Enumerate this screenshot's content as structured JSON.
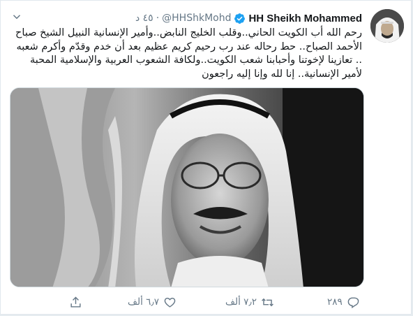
{
  "tweet": {
    "author": {
      "display_name": "HH Sheikh Mohammed",
      "handle": "@HHShkMohd",
      "verified_icon": "verified-badge-icon",
      "avatar_icon": "profile-avatar"
    },
    "separator": "·",
    "time": "٤٥ د",
    "menu_icon": "chevron-down-icon",
    "text_lines": [
      "رحم الله أب الكويت الحاني..وقلب الخليج النابض..وأمير الإنسانية النبيل الشيخ صباح",
      "الأحمد الصباح.. حط رحاله عند رب رحيم كريم عظيم بعد أن خدم وقدّم وأكرم شعبه",
      ".. تعازينا لإخوتنا وأحبابنا شعب الكويت..ولكافة الشعوب العربية والإسلامية المحبة",
      "لأمير الإنسانية.. إنا لله وإنا إليه راجعون"
    ],
    "media": {
      "type": "photo",
      "style": "black-and-white portrait"
    },
    "actions": {
      "reply": {
        "count": "٢٨٩",
        "icon": "reply-icon"
      },
      "retweet": {
        "count": "٧٫٢ ألف",
        "icon": "retweet-icon"
      },
      "like": {
        "count": "٦٫٧ ألف",
        "icon": "heart-icon"
      },
      "share": {
        "icon": "share-icon"
      }
    },
    "colors": {
      "name": "#14171a",
      "secondary": "#657786",
      "verified": "#1da1f2",
      "border": "#e1e8ed"
    }
  }
}
